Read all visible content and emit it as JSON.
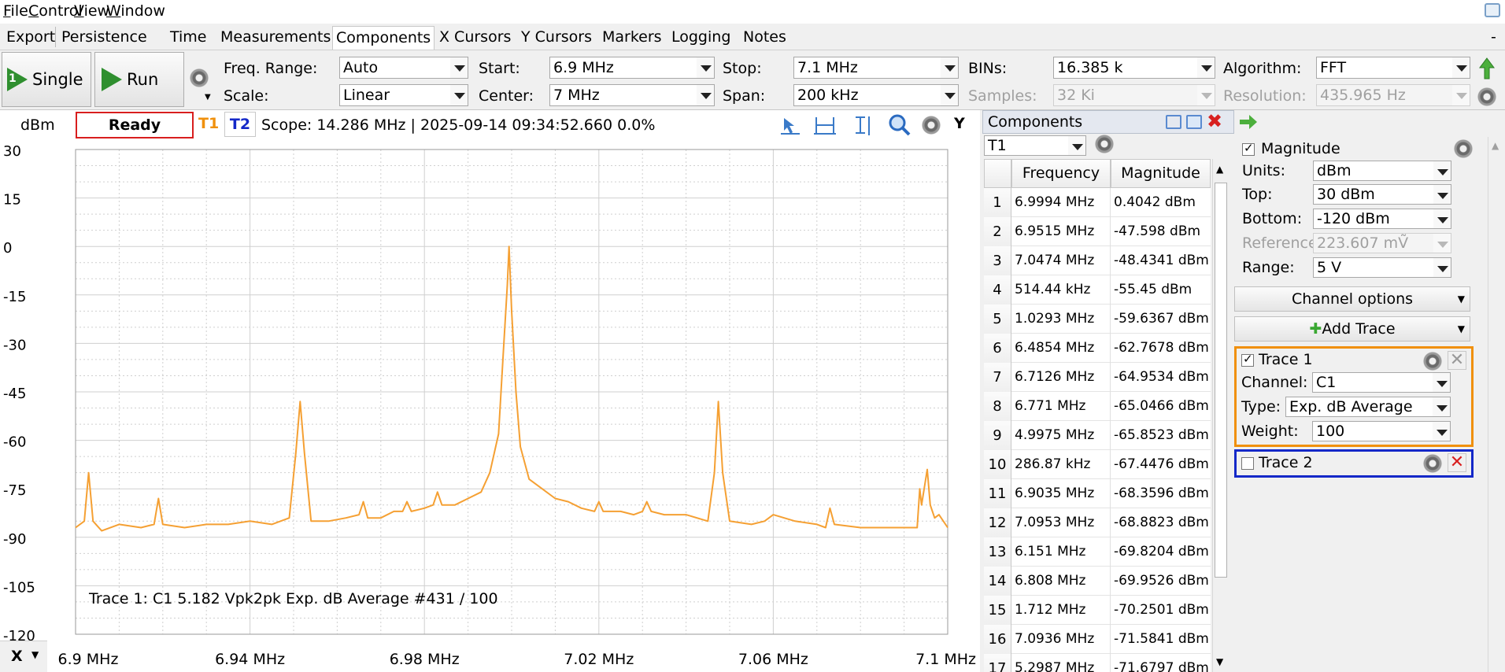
{
  "menu": [
    "File",
    "Control",
    "View",
    "Window"
  ],
  "menu_mnemonics": [
    "F",
    "C",
    "V",
    "W"
  ],
  "tabs": [
    "Export",
    "Persistence",
    "Time",
    "Measurements",
    "Components",
    "X Cursors",
    "Y Cursors",
    "Markers",
    "Logging",
    "Notes"
  ],
  "active_tab": "Components",
  "tabbar_right": "-",
  "toolbar": {
    "single_label": "Single",
    "single_badge": "1",
    "run_label": "Run",
    "freq_range_label": "Freq. Range:",
    "freq_range_value": "Auto",
    "scale_label": "Scale:",
    "scale_value": "Linear",
    "start_label": "Start:",
    "start_value": "6.9 MHz",
    "center_label": "Center:",
    "center_value": "7 MHz",
    "stop_label": "Stop:",
    "stop_value": "7.1 MHz",
    "span_label": "Span:",
    "span_value": "200 kHz",
    "bins_label": "BINs:",
    "bins_value": "16.385 k",
    "samples_label": "Samples:",
    "samples_value": "32 Ki",
    "algorithm_label": "Algorithm:",
    "algorithm_value": "FFT",
    "resolution_label": "Resolution:",
    "resolution_value": "435.965 Hz"
  },
  "plot": {
    "y_unit": "dBm",
    "status": "Ready",
    "t1": "T1",
    "t2": "T2",
    "scope_info": "Scope: 14.286 MHz | 2025-09-14 09:34:52.660 0.0%",
    "y_axis_button": "Y",
    "x_axis_button": "X",
    "trace_info": "Trace 1: C1 5.182 Vpk2pk Exp. dB Average #431 / 100",
    "trace_color": "#f5a033",
    "y_ticks": [
      "30",
      "15",
      "0",
      "-15",
      "-30",
      "-45",
      "-60",
      "-75",
      "-90",
      "-105",
      "-120"
    ],
    "x_ticks": [
      "6.9 MHz",
      "6.94 MHz",
      "6.98 MHz",
      "7.02 MHz",
      "7.06 MHz",
      "7.1 MHz"
    ]
  },
  "chart_data": {
    "type": "line",
    "title": "",
    "xlabel": "",
    "ylabel": "dBm",
    "xlim": [
      6.9,
      7.1
    ],
    "ylim": [
      -120,
      30
    ],
    "grid": true,
    "series": [
      {
        "name": "Trace 1",
        "x": [
          6.9,
          6.902,
          6.903,
          6.904,
          6.906,
          6.91,
          6.915,
          6.918,
          6.919,
          6.92,
          6.925,
          6.93,
          6.935,
          6.94,
          6.945,
          6.949,
          6.9505,
          6.9515,
          6.9525,
          6.954,
          6.958,
          6.962,
          6.965,
          6.966,
          6.967,
          6.97,
          6.973,
          6.975,
          6.976,
          6.977,
          6.98,
          6.982,
          6.983,
          6.984,
          6.987,
          6.99,
          6.993,
          6.995,
          6.997,
          6.998,
          6.999,
          6.9994,
          7.0,
          7.001,
          7.002,
          7.004,
          7.007,
          7.01,
          7.013,
          7.016,
          7.019,
          7.02,
          7.021,
          7.025,
          7.028,
          7.03,
          7.031,
          7.032,
          7.035,
          7.04,
          7.045,
          7.0465,
          7.0474,
          7.0484,
          7.05,
          7.055,
          7.058,
          7.06,
          7.065,
          7.07,
          7.072,
          7.073,
          7.074,
          7.08,
          7.085,
          7.09,
          7.093,
          7.0936,
          7.094,
          7.0953,
          7.096,
          7.097,
          7.098,
          7.1
        ],
        "y": [
          -87,
          -85,
          -70,
          -85,
          -88,
          -86,
          -87,
          -86,
          -78,
          -86,
          -87,
          -86,
          -86,
          -85,
          -86,
          -84,
          -64,
          -48,
          -64,
          -85,
          -85,
          -84,
          -83,
          -79,
          -84,
          -84,
          -82,
          -82,
          -79,
          -82,
          -81,
          -80,
          -76,
          -80,
          -80,
          -78,
          -76,
          -70,
          -58,
          -35,
          -12,
          0,
          -20,
          -45,
          -62,
          -72,
          -75,
          -78,
          -79,
          -81,
          -82,
          -79,
          -82,
          -82,
          -83,
          -82,
          -79,
          -82,
          -83,
          -83,
          -85,
          -70,
          -48,
          -70,
          -85,
          -86,
          -85,
          -83,
          -85,
          -86,
          -87,
          -81,
          -86,
          -87,
          -87,
          -87,
          -87,
          -75,
          -80,
          -69,
          -80,
          -84,
          -83,
          -87
        ]
      }
    ]
  },
  "components": {
    "title": "Components",
    "selector_value": "T1",
    "col_frequency": "Frequency",
    "col_magnitude": "Magnitude",
    "rows": [
      {
        "n": "1",
        "freq": "6.9994 MHz",
        "mag": "0.4042 dBm"
      },
      {
        "n": "2",
        "freq": "6.9515 MHz",
        "mag": "-47.598 dBm"
      },
      {
        "n": "3",
        "freq": "7.0474 MHz",
        "mag": "-48.4341 dBm"
      },
      {
        "n": "4",
        "freq": "514.44 kHz",
        "mag": "-55.45 dBm"
      },
      {
        "n": "5",
        "freq": "1.0293 MHz",
        "mag": "-59.6367 dBm"
      },
      {
        "n": "6",
        "freq": "6.4854 MHz",
        "mag": "-62.7678 dBm"
      },
      {
        "n": "7",
        "freq": "6.7126 MHz",
        "mag": "-64.9534 dBm"
      },
      {
        "n": "8",
        "freq": "6.771 MHz",
        "mag": "-65.0466 dBm"
      },
      {
        "n": "9",
        "freq": "4.9975 MHz",
        "mag": "-65.8523 dBm"
      },
      {
        "n": "10",
        "freq": "286.87 kHz",
        "mag": "-67.4476 dBm"
      },
      {
        "n": "11",
        "freq": "6.9035 MHz",
        "mag": "-68.3596 dBm"
      },
      {
        "n": "12",
        "freq": "7.0953 MHz",
        "mag": "-68.8823 dBm"
      },
      {
        "n": "13",
        "freq": "6.151 MHz",
        "mag": "-69.8204 dBm"
      },
      {
        "n": "14",
        "freq": "6.808 MHz",
        "mag": "-69.9526 dBm"
      },
      {
        "n": "15",
        "freq": "1.712 MHz",
        "mag": "-70.2501 dBm"
      },
      {
        "n": "16",
        "freq": "7.0936 MHz",
        "mag": "-71.5841 dBm"
      },
      {
        "n": "17",
        "freq": "5.2987 MHz",
        "mag": "-71.6797 dBm"
      }
    ]
  },
  "settings": {
    "magnitude_label": "Magnitude",
    "units_label": "Units:",
    "units_value": "dBm",
    "top_label": "Top:",
    "top_value": "30 dBm",
    "bottom_label": "Bottom:",
    "bottom_value": "-120 dBm",
    "reference_label": "Reference:",
    "reference_value": "223.607 mṼ",
    "range_label": "Range:",
    "range_value": "5 V",
    "channel_options": "Channel options",
    "add_trace": "Add Trace",
    "trace1_label": "Trace 1",
    "channel_label": "Channel:",
    "channel_value": "C1",
    "type_label": "Type:",
    "type_value": "Exp. dB Average",
    "weight_label": "Weight:",
    "weight_value": "100",
    "trace2_label": "Trace 2",
    "trace1_color": "#f0900c",
    "trace2_color": "#1428c8"
  }
}
